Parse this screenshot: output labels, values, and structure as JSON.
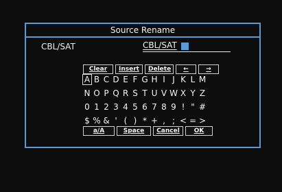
{
  "dialog": {
    "title": "Source Rename",
    "source_label": "CBL/SAT",
    "name_value": "CBL/SAT"
  },
  "top_buttons": [
    "Clear",
    "Insert",
    "Delete",
    "←",
    "→"
  ],
  "keyboard_rows": [
    [
      "A",
      "B",
      "C",
      "D",
      "E",
      "F",
      "G",
      "H",
      "I",
      "J",
      "K",
      "L",
      "M"
    ],
    [
      "N",
      "O",
      "P",
      "Q",
      "R",
      "S",
      "T",
      "U",
      "V",
      "W",
      "X",
      "Y",
      "Z"
    ],
    [
      "0",
      "1",
      "2",
      "3",
      "4",
      "5",
      "6",
      "7",
      "8",
      "9",
      "!",
      "\"",
      "#"
    ],
    [
      "$",
      "%",
      "&",
      "'",
      "(",
      ")",
      "*",
      "+",
      ",",
      ";",
      "<",
      "=",
      ">"
    ]
  ],
  "selected_key": "A",
  "bottom_buttons": [
    "a/A",
    "Space",
    "Cancel",
    "OK"
  ],
  "colors": {
    "frame": "#5b9bd5",
    "cursor": "#5b9bd5",
    "background": "#0d0d0d",
    "text": "#f4f4f4"
  }
}
